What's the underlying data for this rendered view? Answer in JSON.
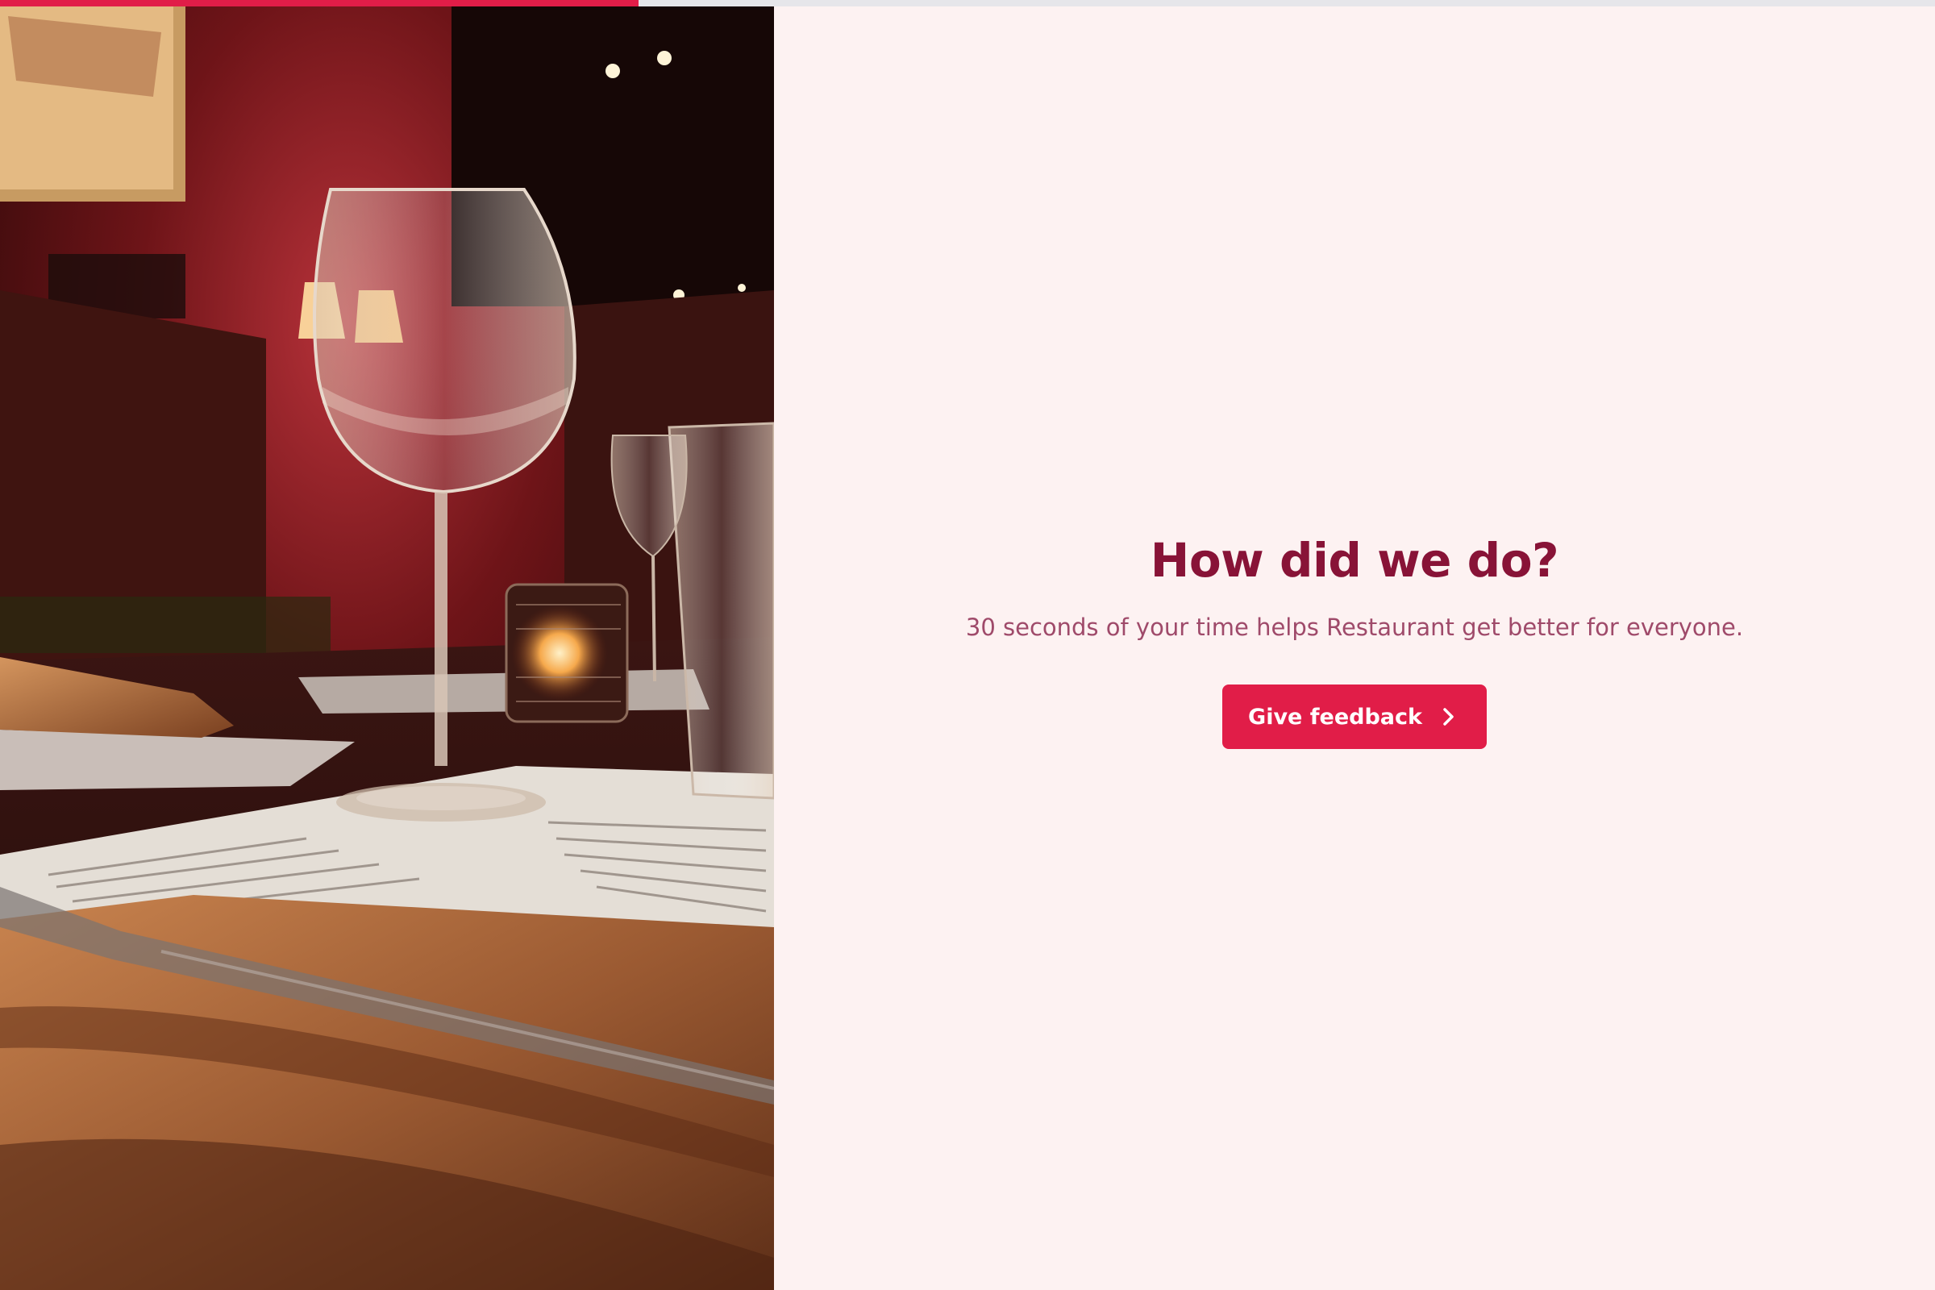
{
  "progress": {
    "fraction": 0.33,
    "color": "#e11d48"
  },
  "hero_image": {
    "description_icon": "restaurant-table-photo"
  },
  "intro": {
    "title": "How did we do?",
    "subtitle": "30 seconds of your time helps Restaurant get better for everyone.",
    "button_label": "Give feedback",
    "button_icon": "chevron-right-icon"
  },
  "colors": {
    "accent": "#e11d48",
    "title": "#881337",
    "subtitle": "#9f4a6a",
    "background": "#fdf2f2"
  }
}
